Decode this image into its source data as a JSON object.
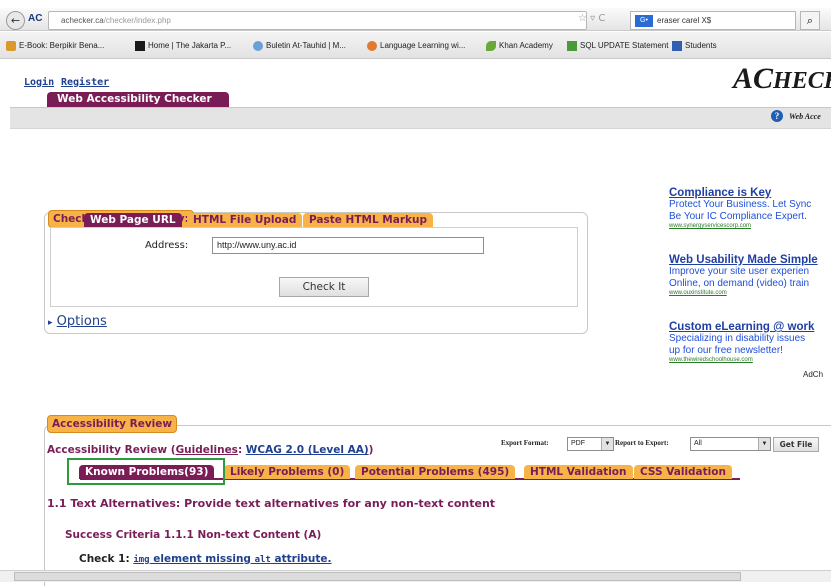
{
  "browser": {
    "back_glyph": "←",
    "site_badge": "AC",
    "url_host": "achecker.ca",
    "url_path": "/checker/index.php",
    "url_icons": "☆ ▿ C",
    "search_engine": "G•",
    "search_query": "eraser carel X$",
    "search_glyph": "⌕"
  },
  "bookmarks": [
    {
      "label": "E-Book: Berpikir Bena...",
      "color": "#d99a2b"
    },
    {
      "label": "Home | The Jakarta P...",
      "color": "#1a1a1a"
    },
    {
      "label": "Buletin At-Tauhid | M...",
      "color": "#6aa0d8"
    },
    {
      "label": "Language Learning wi...",
      "color": "#e07a2e"
    },
    {
      "label": "Khan Academy",
      "color": "#6aa83a"
    },
    {
      "label": "SQL UPDATE Statement",
      "color": "#4a9a3a"
    },
    {
      "label": "Students",
      "color": "#2f5fb0"
    }
  ],
  "header": {
    "login": "Login",
    "register": "Register",
    "site_tab": "Web Accessibility Checker",
    "logo_a": "AC",
    "logo_rest": "HECK",
    "help": "Web Acce"
  },
  "check": {
    "legend": "Check Accessibility By:",
    "tabs": [
      "Web Page URL",
      "HTML File Upload",
      "Paste HTML Markup"
    ],
    "address_label": "Address:",
    "address_value": "http://www.uny.ac.id",
    "button": "Check It",
    "options_arrow": "▸",
    "options": "Options"
  },
  "ads": [
    {
      "title": "Compliance is Key",
      "line1": "Protect Your Business. Let Sync",
      "line2": "Be Your IC Compliance Expert.",
      "url": "www.synergyservicescorp.com"
    },
    {
      "title": "Web Usability Made Simple",
      "line1": "Improve your site user experien",
      "line2": "Online, on demand (video) train",
      "url": "www.ouxinstitute.com"
    },
    {
      "title": "Custom eLearning @ work",
      "line1": "Specializing in disability issues",
      "line2": "up for our free newsletter!",
      "url": "www.thewiredschoolhouse.com"
    }
  ],
  "ad_choices": "AdCh",
  "review": {
    "legend": "Accessibility Review",
    "title_prefix": "Accessibility Review (",
    "guidelines": "Guidelines",
    "title_sep": ": ",
    "wcag": "WCAG 2.0 (Level AA)",
    "title_suffix": ")",
    "export_format_label": "Export Format:",
    "export_format_value": "PDF",
    "report_label": "Report to Export:",
    "report_value": "All",
    "get_file": "Get File",
    "tabs": [
      "Known Problems(93)",
      "Likely Problems (0)",
      "Potential Problems (495)",
      "HTML Validation",
      "CSS Validation"
    ],
    "heading1": "1.1 Text Alternatives: Provide text alternatives for any non-text content",
    "heading2": "Success Criteria 1.1.1 Non-text Content (A)",
    "check_prefix": "Check 1: ",
    "check_code1": "img",
    "check_mid": " element missing ",
    "check_code2": "alt",
    "check_suffix": " attribute."
  },
  "colors": {
    "accent": "#7a1d57",
    "tab_orange": "#f7b348",
    "highlight_box": "#2e9a3e",
    "link": "#1f3f8f"
  }
}
